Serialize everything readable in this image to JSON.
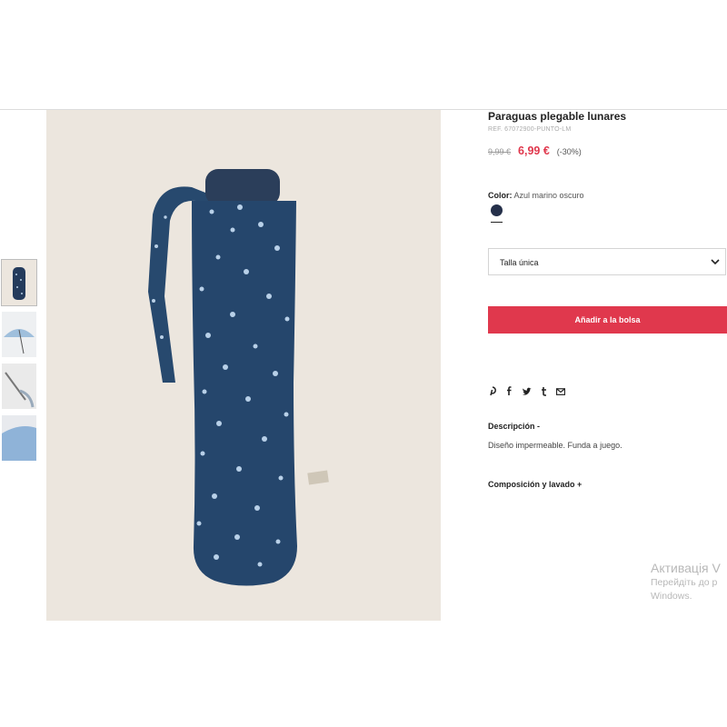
{
  "product": {
    "title": "Paraguas plegable lunares",
    "ref": "REF. 67072900-PUNTO-LM",
    "old_price": "9,99 €",
    "new_price": "6,99 €",
    "discount": "(-30%)",
    "color_label": "Color:",
    "color_value": "Azul marino oscuro",
    "swatch_color": "#25304a",
    "size_value": "Talla única",
    "add_to_bag_label": "Añadir a la bolsa",
    "accent_color": "#e0384d"
  },
  "share_icons": [
    "pinterest-icon",
    "facebook-icon",
    "twitter-icon",
    "tumblr-icon",
    "email-icon"
  ],
  "share_glyphs": [
    "𝓅",
    "f",
    "🐦",
    "t",
    "✉"
  ],
  "description": {
    "heading": "Descripción -",
    "text": "Diseño impermeable. Funda a juego."
  },
  "composition": {
    "heading": "Composición y lavado +"
  },
  "thumbnails": [
    "umbrella-folded",
    "umbrella-open",
    "umbrella-detail",
    "umbrella-canopy"
  ],
  "watermark": {
    "title": "Активація V",
    "line1": "Перейдіть до р",
    "line2": "Windows."
  }
}
